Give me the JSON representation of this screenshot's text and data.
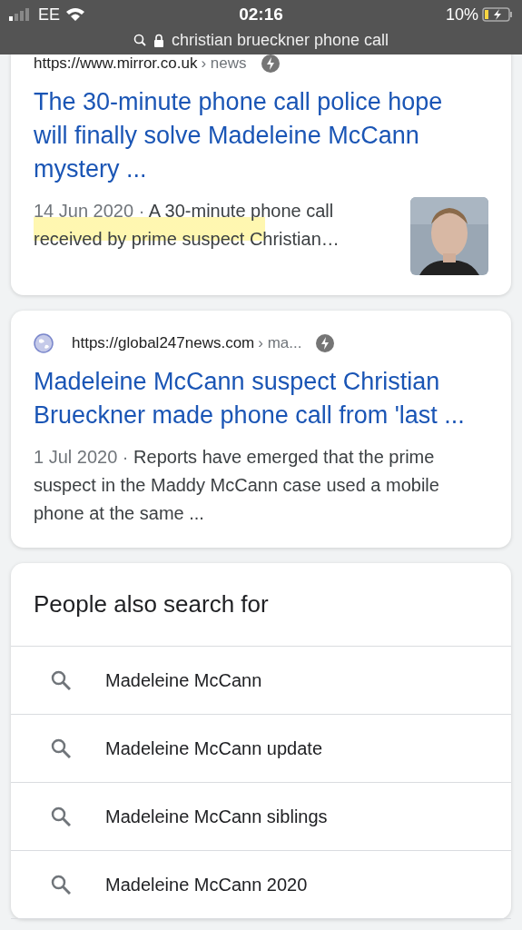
{
  "status_bar": {
    "carrier": "EE",
    "time": "02:16",
    "battery": "10%",
    "address": "christian brueckner phone call"
  },
  "results": [
    {
      "domain": "https://www.mirror.co.uk",
      "path": "› news",
      "favicon": false,
      "title": "The 30-minute phone call police hope will finally solve Madeleine McCann mystery ...",
      "date": "14 Jun 2020 · ",
      "snippet": "A 30-minute phone call received by prime suspect Christian…",
      "highlighted": true
    },
    {
      "domain": "https://global247news.com",
      "path": "› ma...",
      "favicon": true,
      "title": "Madeleine McCann suspect Christian Brueckner made phone call from 'last ...",
      "date": "1 Jul 2020 · ",
      "snippet": "Reports have emerged that the prime suspect in the Maddy McCann case used a mobile phone at the same  ...",
      "highlighted": false
    }
  ],
  "people_also_search": {
    "heading": "People also search for",
    "items": [
      "Madeleine McCann",
      "Madeleine McCann update",
      "Madeleine McCann siblings",
      "Madeleine McCann 2020"
    ]
  }
}
